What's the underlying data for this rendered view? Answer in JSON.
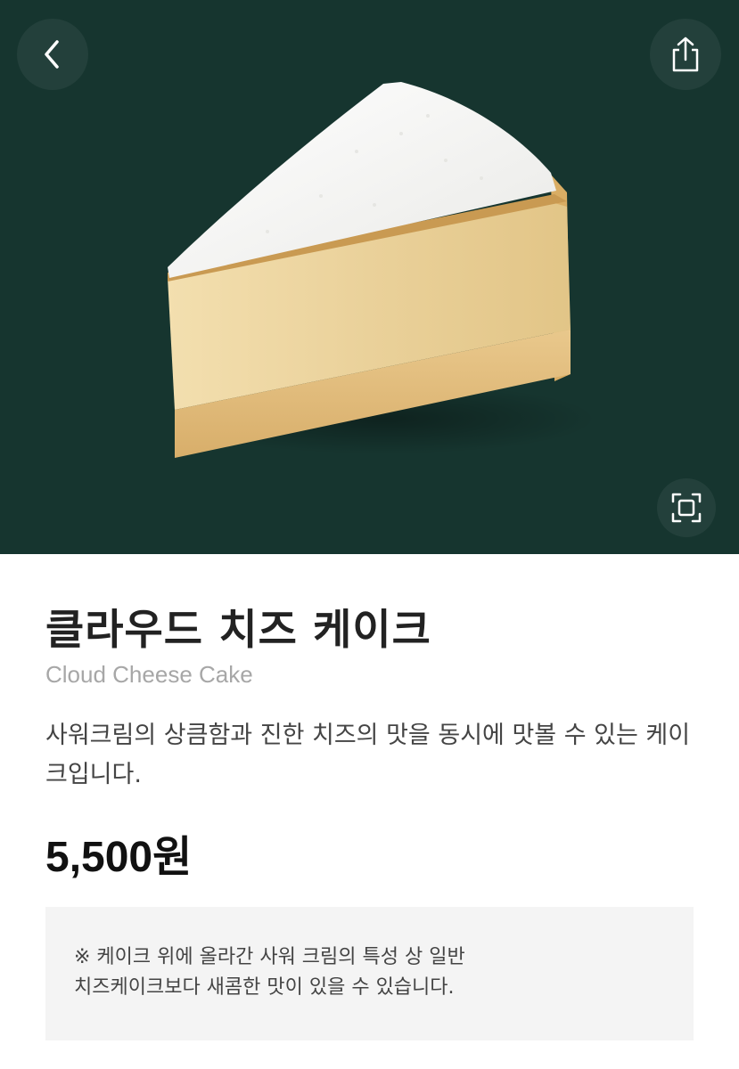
{
  "product": {
    "name_ko": "클라우드 치즈 케이크",
    "name_en": "Cloud Cheese Cake",
    "description": "사워크림의 상큼함과 진한 치즈의 맛을 동시에 맛볼 수 있는 케이크입니다.",
    "price": "5,500원",
    "notice_line1": "※ 케이크 위에 올라간 사워 크림의 특성 상 일반",
    "notice_line2": "치즈케이크보다 새콤한 맛이 있을 수 있습니다."
  },
  "icons": {
    "back": "chevron-left-icon",
    "share": "share-icon",
    "expand": "expand-icon"
  },
  "colors": {
    "hero_background": "#16352f",
    "notice_background": "#f4f4f4",
    "subtitle": "#a7a7a7"
  }
}
